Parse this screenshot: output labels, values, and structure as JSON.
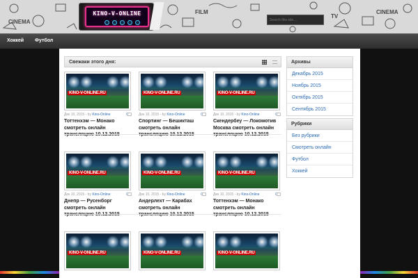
{
  "header": {
    "logo_text": "KINO-V-ONLINE",
    "search_placeholder": "Search this site..."
  },
  "nav": {
    "items": [
      {
        "label": "Хоккей"
      },
      {
        "label": "Футбол"
      }
    ]
  },
  "main": {
    "title": "Свежаки этого дня:",
    "posts": [
      {
        "date": "Дек 10, 2015",
        "by": "- by",
        "author": "Kino-Online",
        "comments": "0",
        "title": "Тоттенхэм — Монако смотреть онлайн трансляцию 10.12.2015",
        "watermark": "KINO-V-ONLINE.RU"
      },
      {
        "date": "Дек 10, 2015",
        "by": "- by",
        "author": "Kino-Online",
        "comments": "0",
        "title": "Спортинг — Бешикташ смотреть онлайн трансляцию 10.12.2015",
        "watermark": "KINO-V-ONLINE.RU"
      },
      {
        "date": "Дек 10, 2015",
        "by": "- by",
        "author": "Kino-Online",
        "comments": "0",
        "title": "Скендербеу — Локомотив Москва смотреть онлайн трансляцию 10.12.2015",
        "watermark": "KINO-V-ONLINE.RU"
      },
      {
        "date": "Дек 10, 2015",
        "by": "- by",
        "author": "Kino-Online",
        "comments": "0",
        "title": "Днепр — Русенборг смотреть онлайн трансляцию 10.12.2015",
        "watermark": "KINO-V-ONLINE.RU"
      },
      {
        "date": "Дек 10, 2015",
        "by": "- by",
        "author": "Kino-Online",
        "comments": "0",
        "title": "Андерлехт — Карабах смотреть онлайн трансляцию 10.12.2015",
        "watermark": "KINO-V-ONLINE.RU"
      },
      {
        "date": "Дек 10, 2015",
        "by": "- by",
        "author": "Kino-Online",
        "comments": "0",
        "title": "Тоттенхэм — Монако смотреть онлайн трансляцию 10.12.2015",
        "watermark": "KINO-V-ONLINE.RU"
      },
      {
        "watermark": "KINO-V-ONLINE.RU"
      },
      {
        "watermark": "KINO-V-ONLINE.RU"
      },
      {
        "watermark": "KINO-V-ONLINE.RU"
      }
    ]
  },
  "sidebar": {
    "archives": {
      "title": "Архивы",
      "items": [
        "Декабрь 2015",
        "Ноябрь 2015",
        "Октябрь 2015",
        "Сентябрь 2015"
      ]
    },
    "categories": {
      "title": "Рубрики",
      "items": [
        "Без рубрики",
        "Смотреть онлайн",
        "Футбол",
        "Хоккей"
      ]
    }
  },
  "colors": {
    "link": "#2a6ab3",
    "nav_bg": "#3a3a3a",
    "logo_neon": "#e8308c"
  },
  "icons": [
    "search-icon",
    "grid-view-icon",
    "list-view-icon",
    "comment-icon"
  ]
}
